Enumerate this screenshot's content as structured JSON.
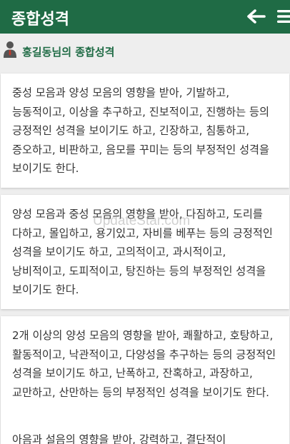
{
  "app_bar": {
    "title": "종합성격",
    "background": "#1f6b45"
  },
  "subheader": {
    "title": "홍길동님의 종합성격",
    "color": "#1f6b45"
  },
  "watermark": "UpdateStar.com",
  "cards": [
    {
      "text": "중성 모음과 양성 모음의 영향을 받아, 기발하고, 능동적이고, 이상을 추구하고, 진보적이고, 진행하는 등의 긍정적인 성격을 보이기도 하고, 긴장하고, 침통하고, 증오하고, 비판하고, 음모를 꾸미는 등의 부정적인 성격을 보이기도 한다."
    },
    {
      "text": "양성 모음과 중성 모음의 영향을 받아, 다짐하고, 도리를 다하고, 몰입하고, 용기있고, 자비를 베푸는 등의 긍정적인 성격을 보이기도 하고, 고의적이고, 과시적이고, 낭비적이고, 도피적이고, 탕진하는 등의 부정적인 성격을 보이기도 한다."
    },
    {
      "text": "2개 이상의 양성 모음의 영향을 받아, 쾌활하고, 호탕하고, 활동적이고, 낙관적이고, 다양성을 추구하는 등의 긍정적인 성격을 보이기도 하고, 난폭하고, 잔혹하고, 과장하고, 교만하고, 산만하는 등의 부정적인 성격을 보이기도 한다.",
      "text_2": "아음과 설음의 영향을 받아, 강력하고, 결단적이"
    }
  ]
}
